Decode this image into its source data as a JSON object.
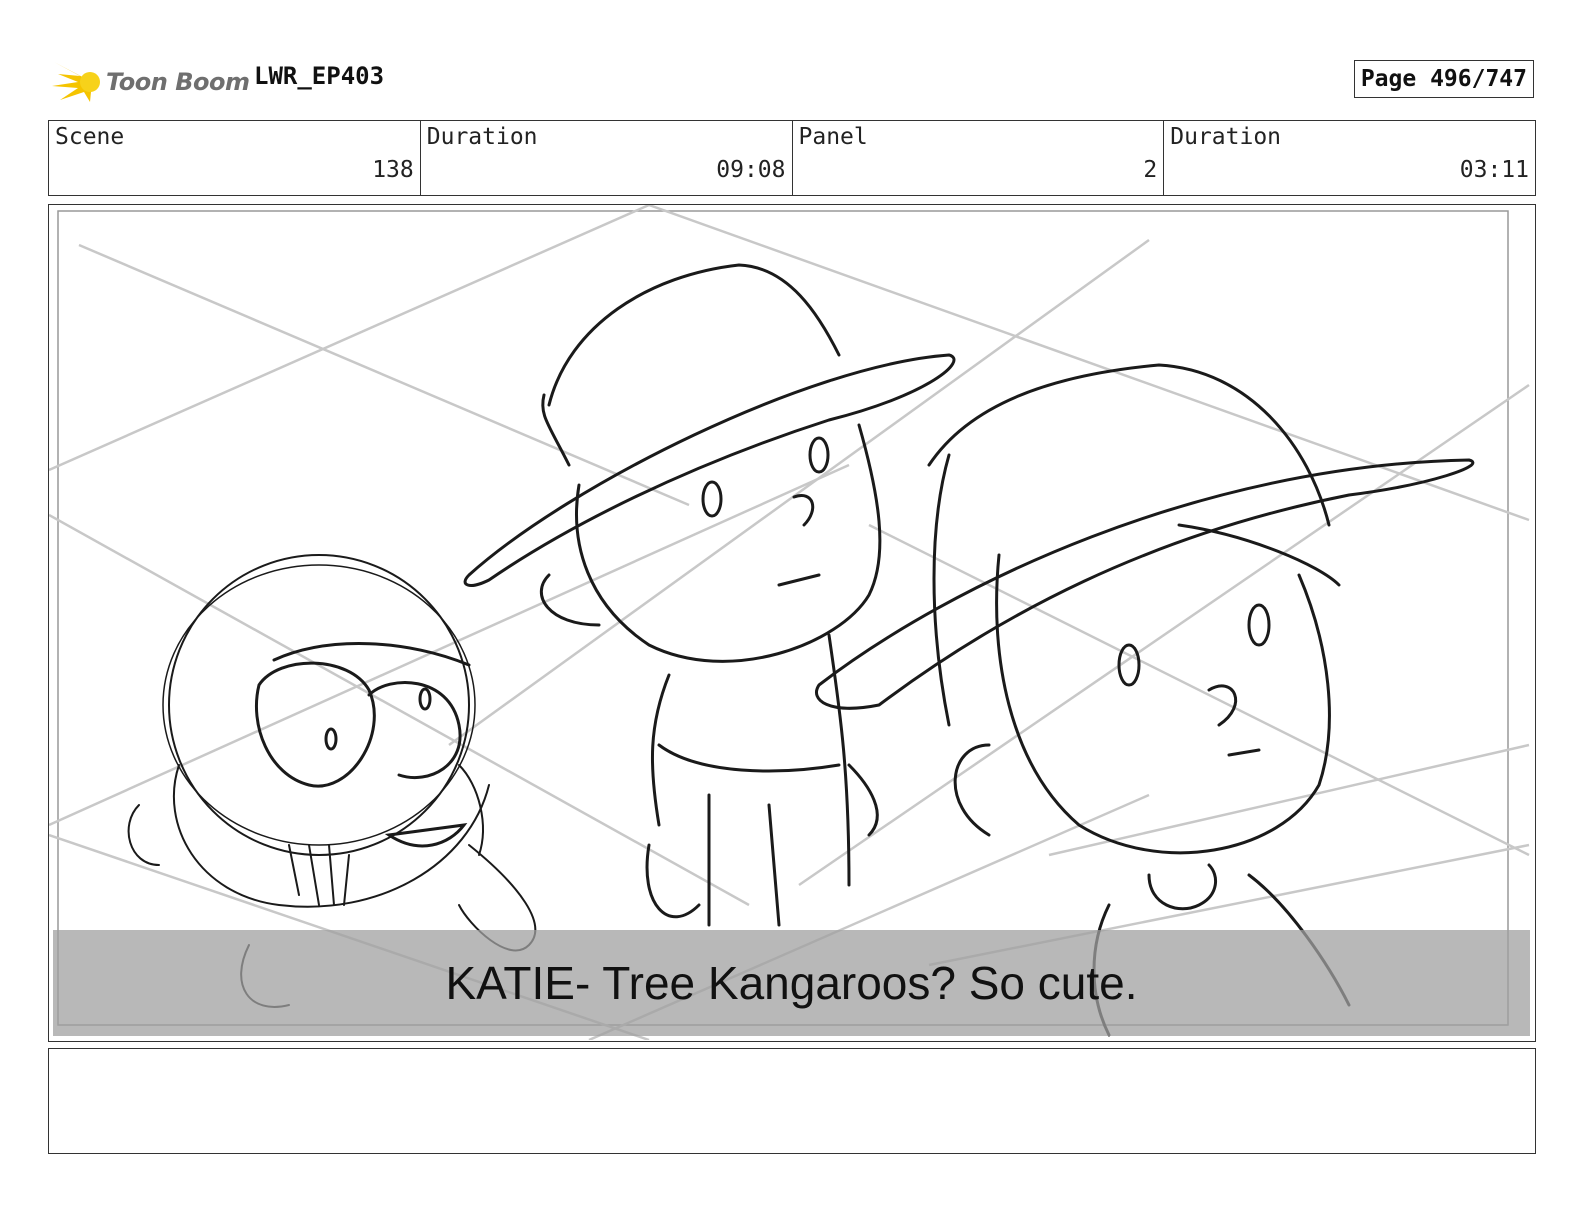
{
  "header": {
    "logo_text": "Toon Boom",
    "project": "LWR_EP403",
    "page": "Page 496/747"
  },
  "info": {
    "scene_label": "Scene",
    "scene_value": "138",
    "scene_duration_label": "Duration",
    "scene_duration_value": "09:08",
    "panel_label": "Panel",
    "panel_value": "2",
    "panel_duration_label": "Duration",
    "panel_duration_value": "03:11"
  },
  "panel": {
    "caption": "KATIE- Tree Kangaroos? So cute."
  },
  "notes": {
    "text": ""
  },
  "colors": {
    "logo_accent": "#f5c400",
    "logo_text": "#6f6f6f",
    "caption_bar": "#a0a0a0"
  },
  "icons": {
    "logo": "toon-boom-logo-icon"
  }
}
